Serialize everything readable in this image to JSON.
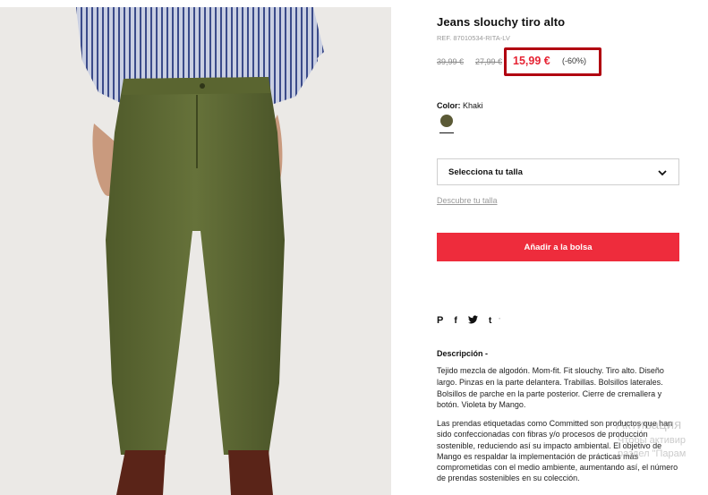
{
  "product": {
    "title": "Jeans slouchy tiro alto",
    "ref": "REF. 87010534-RITA-LV",
    "price_original": "39,99 €",
    "price_previous": "27,99 €",
    "price_current": "15,99 €",
    "discount": "(-60%)"
  },
  "color": {
    "label": "Color:",
    "value": "Khaki",
    "swatch_hex": "#5b5a36"
  },
  "size": {
    "select_label": "Selecciona tu talla",
    "guide_link": "Descubre tu talla"
  },
  "cart": {
    "add_label": "Añadir a la bolsa",
    "button_color": "#ee2c3c"
  },
  "share": {
    "icons": [
      "pinterest-icon",
      "facebook-icon",
      "twitter-icon",
      "tumblr-icon"
    ],
    "pinterest": "P",
    "facebook": "f",
    "twitter": "t",
    "tumblr": "t",
    "more": "'"
  },
  "description": {
    "title": "Descripción -",
    "body": "Tejido mezcla de algodón. Mom-fit. Fit slouchy. Tiro alto. Diseño largo. Pinzas en la parte delantera. Trabillas. Bolsillos laterales. Bolsillos de parche en la parte posterior. Cierre de cremallera y botón. Violeta by Mango.",
    "committed": "Las prendas etiquetadas como Committed son productos que han sido confeccionadas con fibras y/o procesos de producción sostenible, reduciendo así su impacto ambiental. El objetivo de Mango es respaldar la implementación de prácticas más comprometidas con el medio ambiente, aumentando así, el número de prendas sostenibles en su colección."
  },
  "watermark": {
    "line1": "Активация",
    "line2": "Чтобы активир",
    "line3": "раздел \"Парам"
  },
  "colors": {
    "accent_red": "#e62434",
    "highlight_border": "#b10010"
  }
}
